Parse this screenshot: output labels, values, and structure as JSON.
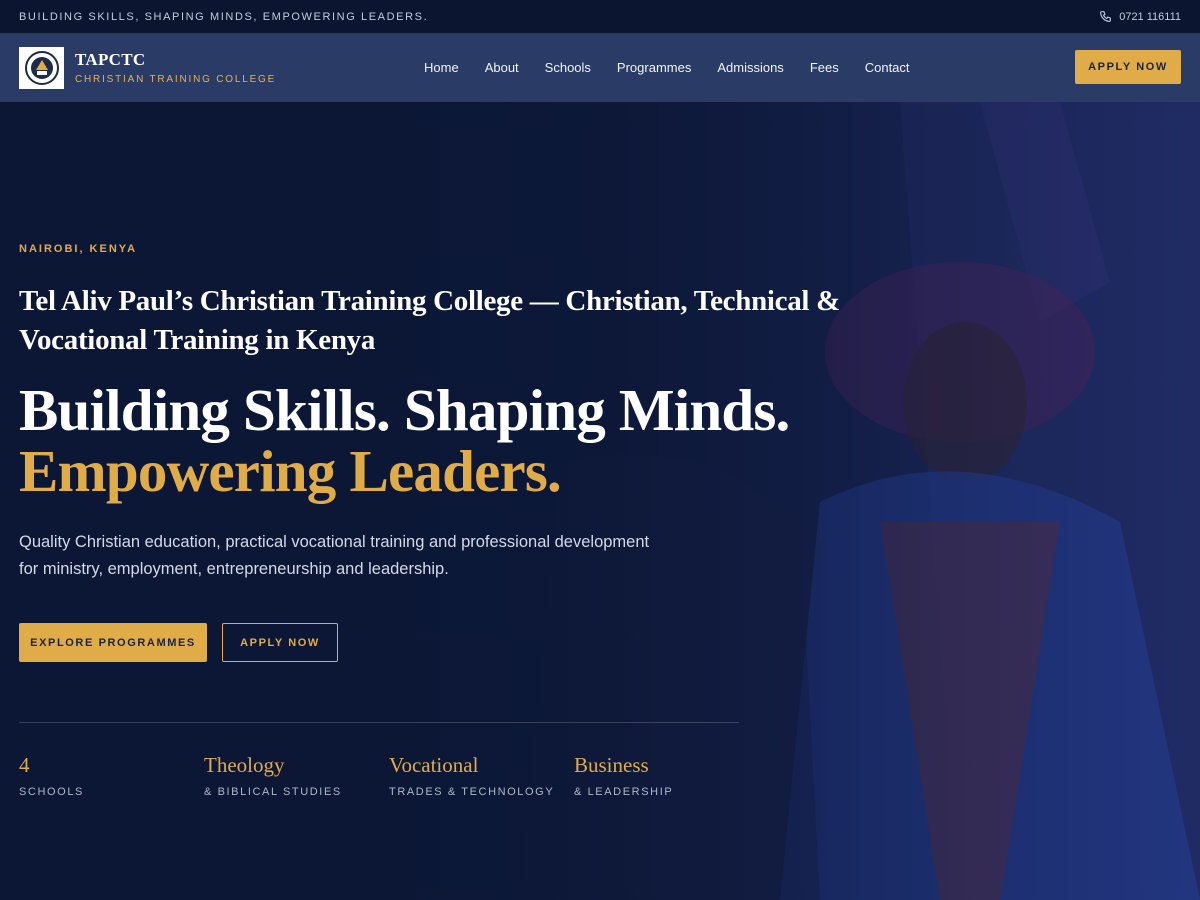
{
  "topbar": {
    "tagline": "BUILDING SKILLS, SHAPING MINDS, EMPOWERING LEADERS.",
    "phone": "0721 116111",
    "phone_icon": "phone-icon"
  },
  "nav": {
    "brand_name": "TAPCTC",
    "brand_sub": "CHRISTIAN TRAINING COLLEGE",
    "logo_icon": "college-crest-logo",
    "items": [
      "Home",
      "About",
      "Schools",
      "Programmes",
      "Admissions",
      "Fees",
      "Contact"
    ],
    "apply_label": "APPLY NOW"
  },
  "hero": {
    "eyebrow": "NAIROBI, KENYA",
    "subtitle": "Tel Aliv Paul’s Christian Training College — Christian, Technical & Vocational Training in Kenya",
    "headline_line1": "Building Skills. Shaping Minds.",
    "headline_line2": "Empowering Leaders.",
    "lead": "Quality Christian education, practical vocational training and professional development for ministry, employment, entrepreneurship and leadership.",
    "primary_cta": "EXPLORE PROGRAMMES",
    "secondary_cta": "APPLY NOW",
    "stats": [
      {
        "value": "4",
        "label": "SCHOOLS"
      },
      {
        "value": "Theology",
        "label": "& BIBLICAL STUDIES"
      },
      {
        "value": "Vocational",
        "label": "TRADES & TECHNOLOGY"
      },
      {
        "value": "Business",
        "label": "& LEADERSHIP"
      }
    ]
  },
  "colors": {
    "accent": "#e0ac48",
    "navy": "#0c1736",
    "nav_bg": "#2a3b66"
  }
}
